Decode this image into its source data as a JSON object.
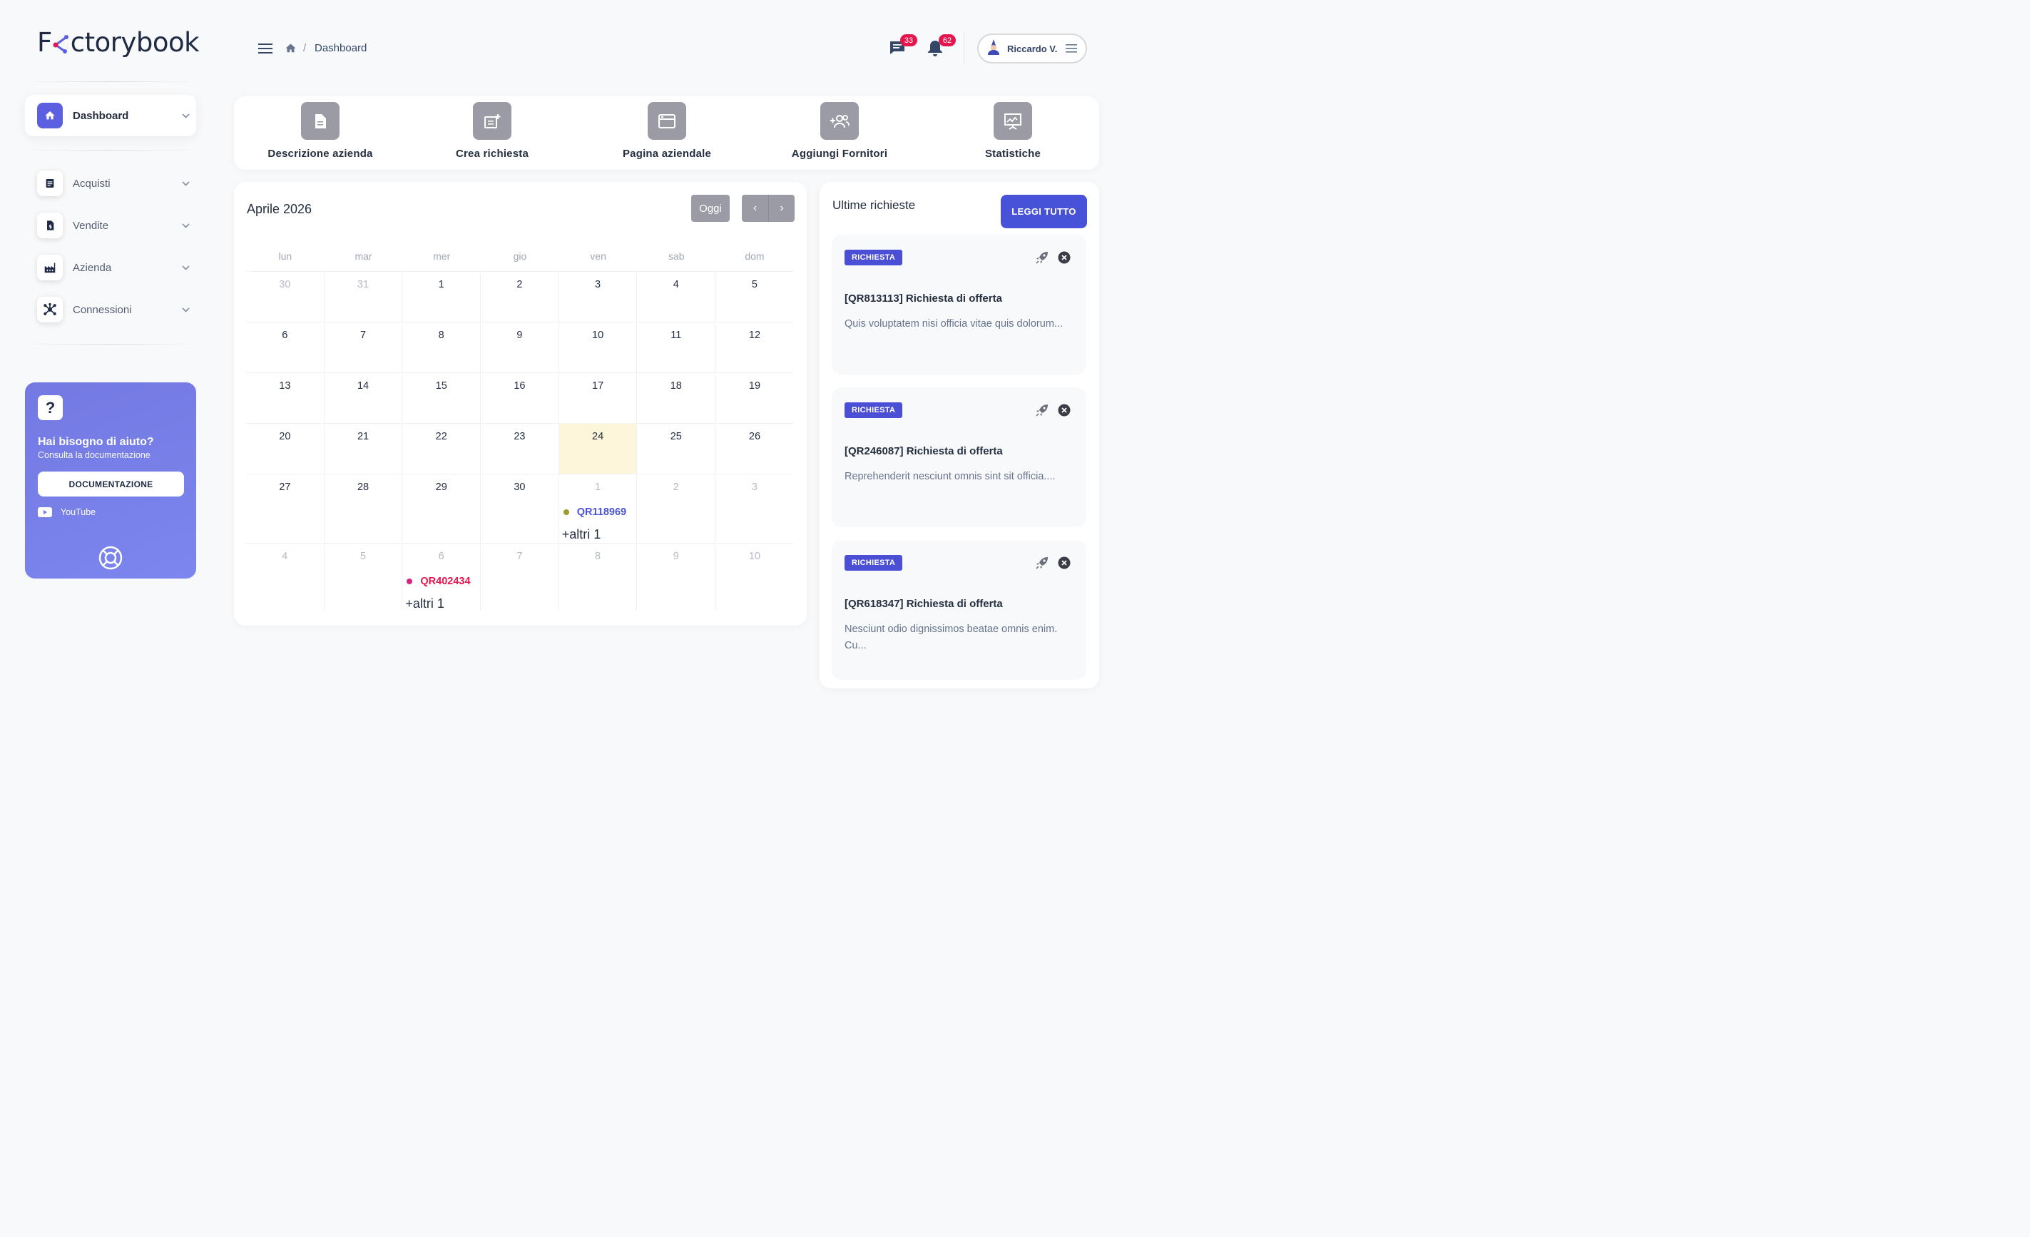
{
  "brand": {
    "name_prefix": "F",
    "name_suffix": "ctorybook"
  },
  "breadcrumb": {
    "current": "Dashboard",
    "separator": "/"
  },
  "header": {
    "messages_count": "33",
    "notifications_count": "62",
    "user_name": "Riccardo V."
  },
  "sidebar": {
    "items": [
      {
        "label": "Dashboard",
        "icon": "home-icon",
        "active": true
      },
      {
        "label": "Acquisti",
        "icon": "document-icon"
      },
      {
        "label": "Vendite",
        "icon": "invoice-icon"
      },
      {
        "label": "Azienda",
        "icon": "factory-icon"
      },
      {
        "label": "Connessioni",
        "icon": "network-icon"
      }
    ],
    "help": {
      "title": "Hai bisogno di aiuto?",
      "subtitle": "Consulta la documentazione",
      "button": "DOCUMENTAZIONE",
      "youtube": "YouTube",
      "question_mark": "?"
    }
  },
  "quick_actions": [
    {
      "label": "Descrizione azienda",
      "icon": "file-icon"
    },
    {
      "label": "Crea richiesta",
      "icon": "new-request-icon"
    },
    {
      "label": "Pagina aziendale",
      "icon": "browser-icon"
    },
    {
      "label": "Aggiungi Fornitori",
      "icon": "add-users-icon"
    },
    {
      "label": "Statistiche",
      "icon": "presentation-chart-icon"
    }
  ],
  "calendar": {
    "title": "Aprile 2026",
    "today_button": "Oggi",
    "prev": "‹",
    "next": "›",
    "weekdays": [
      "lun",
      "mar",
      "mer",
      "gio",
      "ven",
      "sab",
      "dom"
    ],
    "weeks": [
      [
        "30",
        "31",
        "1",
        "2",
        "3",
        "4",
        "5"
      ],
      [
        "6",
        "7",
        "8",
        "9",
        "10",
        "11",
        "12"
      ],
      [
        "13",
        "14",
        "15",
        "16",
        "17",
        "18",
        "19"
      ],
      [
        "20",
        "21",
        "22",
        "23",
        "24",
        "25",
        "26"
      ],
      [
        "27",
        "28",
        "29",
        "30",
        "1",
        "2",
        "3"
      ],
      [
        "4",
        "5",
        "6",
        "7",
        "8",
        "9",
        "10"
      ]
    ],
    "events": [
      {
        "code": "QR118969",
        "more": "+altri 1",
        "dot_color": "#9c9a2a",
        "text_color": "#4b53d8"
      },
      {
        "code": "QR402434",
        "more": "+altri 1",
        "dot_color": "#d8247f",
        "text_color": "#e3174e"
      }
    ]
  },
  "requests": {
    "title": "Ultime richieste",
    "read_all": "LEGGI TUTTO",
    "items": [
      {
        "tag": "RICHIESTA",
        "title": "[QR813113] Richiesta di offerta",
        "body": "Quis voluptatem nisi officia vitae quis dolorum..."
      },
      {
        "tag": "RICHIESTA",
        "title": "[QR246087] Richiesta di offerta",
        "body": "Reprehenderit nesciunt omnis sint sit officia...."
      },
      {
        "tag": "RICHIESTA",
        "title": "[QR618347] Richiesta di offerta",
        "body": "Nesciunt odio dignissimos beatae omnis enim. Cu..."
      }
    ]
  },
  "colors": {
    "accent": "#4752d8",
    "badge": "#e3174e",
    "today": "#fdf6db",
    "action_icon_bg": "#9a9ba5"
  }
}
